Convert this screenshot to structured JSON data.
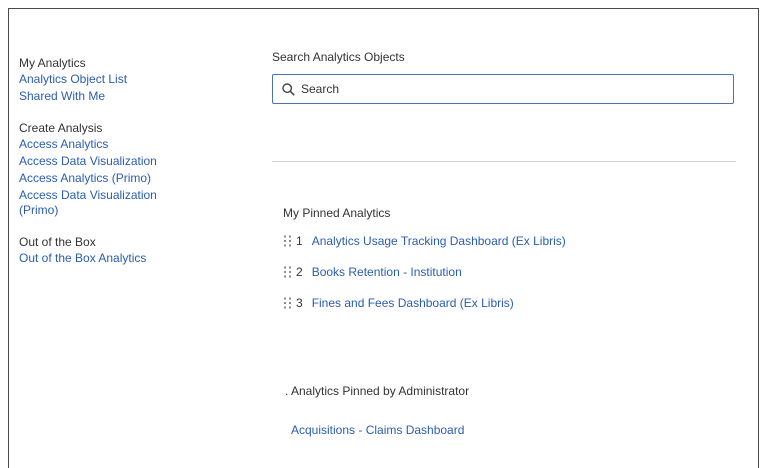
{
  "sidebar": {
    "my_analytics": {
      "heading": "My Analytics",
      "links": [
        "Analytics Object List",
        "Shared With Me"
      ]
    },
    "create_analysis": {
      "heading": "Create Analysis",
      "links": [
        "Access Analytics",
        "Access Data Visualization",
        "Access Analytics (Primo)",
        "Access Data Visualization (Primo)"
      ]
    },
    "out_of_box": {
      "heading": "Out of the Box",
      "links": [
        "Out of the Box Analytics"
      ]
    }
  },
  "search": {
    "label": "Search Analytics Objects",
    "placeholder": "Search",
    "icon": "search-icon"
  },
  "pinned": {
    "heading": "My Pinned Analytics",
    "drag_icon": "drag-handle-icon",
    "items": [
      {
        "num": "1",
        "label": "Analytics Usage Tracking Dashboard (Ex Libris)"
      },
      {
        "num": "2",
        "label": "Books Retention - Institution"
      },
      {
        "num": "3",
        "label": "Fines and Fees Dashboard (Ex Libris)"
      }
    ]
  },
  "admin_pinned": {
    "heading": ". Analytics Pinned by Administrator",
    "items": [
      "Acquisitions - Claims Dashboard"
    ]
  },
  "colors": {
    "link": "#2a5db0",
    "text": "#333333",
    "search_border": "#4a72b6"
  }
}
